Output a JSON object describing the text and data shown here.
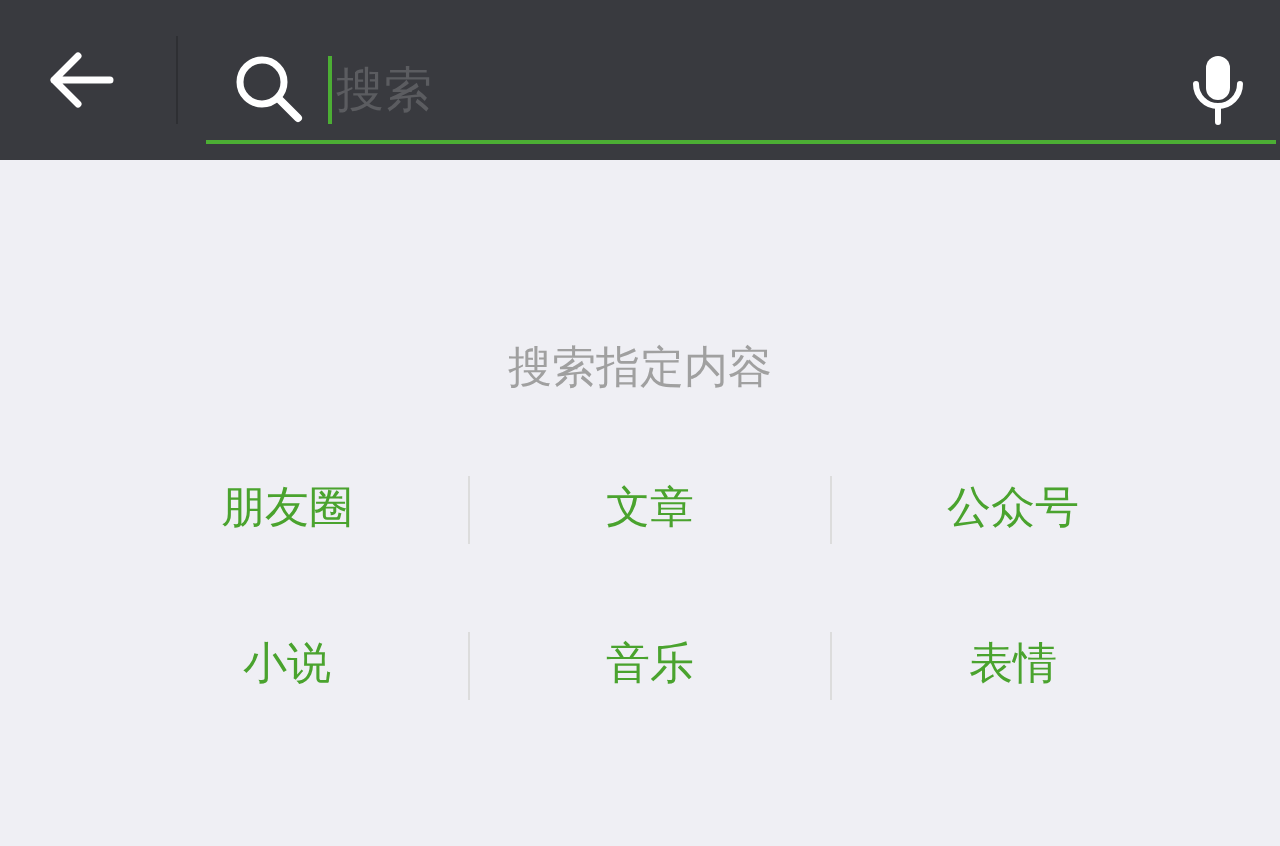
{
  "search": {
    "placeholder": "搜索"
  },
  "section_title": "搜索指定内容",
  "items": [
    {
      "label": "朋友圈"
    },
    {
      "label": "文章"
    },
    {
      "label": "公众号"
    },
    {
      "label": "小说"
    },
    {
      "label": "音乐"
    },
    {
      "label": "表情"
    }
  ]
}
